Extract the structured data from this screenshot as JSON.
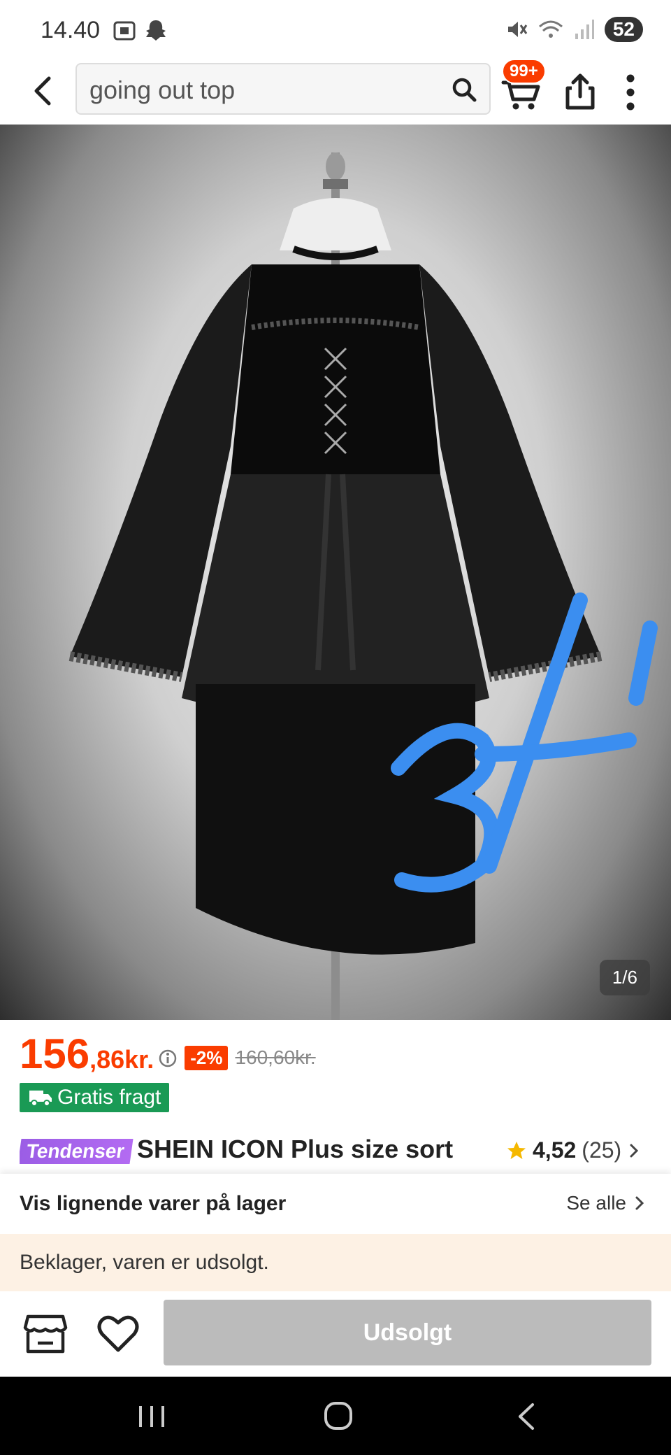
{
  "status_bar": {
    "time": "14.40",
    "battery": "52"
  },
  "header": {
    "search_value": "going out top",
    "cart_badge": "99+"
  },
  "image": {
    "counter": "1/6"
  },
  "price": {
    "main": "156",
    "decimal": ",86kr.",
    "discount": "-2%",
    "original": "160,60kr."
  },
  "shipping": {
    "label": "Gratis fragt"
  },
  "product": {
    "tag": "Tendenser",
    "title": "SHEIN ICON Plus size sort",
    "rating": "4,52",
    "review_count": "(25)"
  },
  "similar": {
    "title": "Vis lignende varer på lager",
    "see_all": "Se alle"
  },
  "notice": {
    "text": "Beklager, varen er udsolgt."
  },
  "bottom": {
    "soldout_label": "Udsolgt"
  },
  "colors": {
    "accent": "#fa3c00",
    "shipping": "#1a9a55",
    "trend": "#9b5de5",
    "disabled": "#bbbbbb"
  }
}
